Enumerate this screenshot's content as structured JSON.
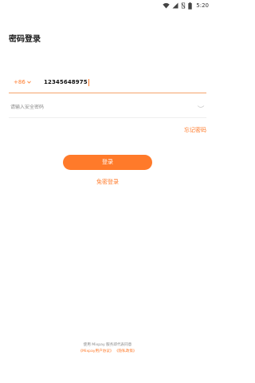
{
  "status_bar": {
    "time": "5:20",
    "icons": [
      "wifi-icon",
      "signal-icon",
      "no-sim-icon",
      "battery-icon"
    ]
  },
  "page": {
    "title": "密码登录"
  },
  "phone": {
    "country_code": "+86",
    "value": "12345648975"
  },
  "password": {
    "placeholder": "请输入安全密码"
  },
  "forgot_label": "忘记密码",
  "login_button": "登录",
  "alt_login": "免密登录",
  "footer": {
    "line1": "使用 Mixpay 服务即代表同意",
    "agreement": "《Mixpay用户协议》",
    "privacy": "《隐私政策》"
  },
  "colors": {
    "accent": "#ff7a2a",
    "text": "#1a1a1a",
    "muted": "#8a8a8a"
  }
}
